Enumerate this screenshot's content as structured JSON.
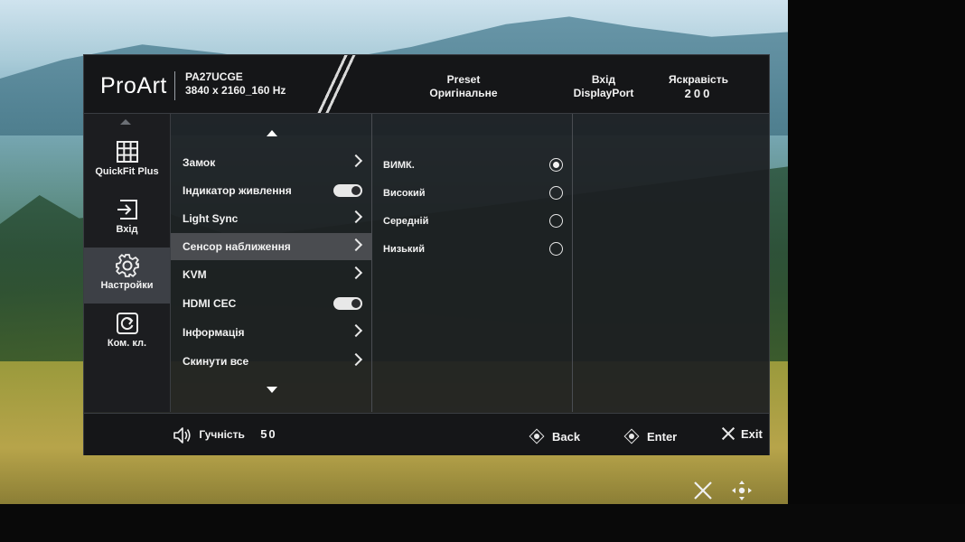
{
  "header": {
    "logo": "ProArt",
    "model": "PA27UCGE",
    "resolution": "3840 x 2160_160 Hz",
    "preset_label": "Preset",
    "preset_value": "Оригінальне",
    "input_label": "Вхід",
    "input_value": "DisplayPort",
    "brightness_label": "Яскравість",
    "brightness_value": "200"
  },
  "nav": {
    "items": [
      {
        "label": "QuickFit Plus",
        "icon": "grid-icon"
      },
      {
        "label": "Вхід",
        "icon": "input-icon"
      },
      {
        "label": "Настройки",
        "icon": "gear-icon"
      },
      {
        "label": "Ком. кл.",
        "icon": "shortcut-icon"
      }
    ]
  },
  "menu": {
    "items": [
      {
        "label": "Замок",
        "control": "chevron"
      },
      {
        "label": "Індикатор живлення",
        "control": "toggle"
      },
      {
        "label": "Light Sync",
        "control": "chevron"
      },
      {
        "label": "Сенсор наближення",
        "control": "chevron"
      },
      {
        "label": "KVM",
        "control": "chevron"
      },
      {
        "label": "HDMI CEC",
        "control": "toggle"
      },
      {
        "label": "Інформація",
        "control": "chevron"
      },
      {
        "label": "Скинути все",
        "control": "chevron"
      }
    ]
  },
  "options": {
    "items": [
      {
        "label": "ВИМК.",
        "selected": true
      },
      {
        "label": "Високий",
        "selected": false
      },
      {
        "label": "Середній",
        "selected": false
      },
      {
        "label": "Низький",
        "selected": false
      }
    ]
  },
  "footer": {
    "volume_label": "Гучність",
    "volume_value": "50",
    "back": "Back",
    "enter": "Enter",
    "exit": "Exit"
  },
  "colors": {
    "panel_bg": "#1c1e21",
    "active_bg": "#4a4c50",
    "text": "#f2f2f2"
  }
}
